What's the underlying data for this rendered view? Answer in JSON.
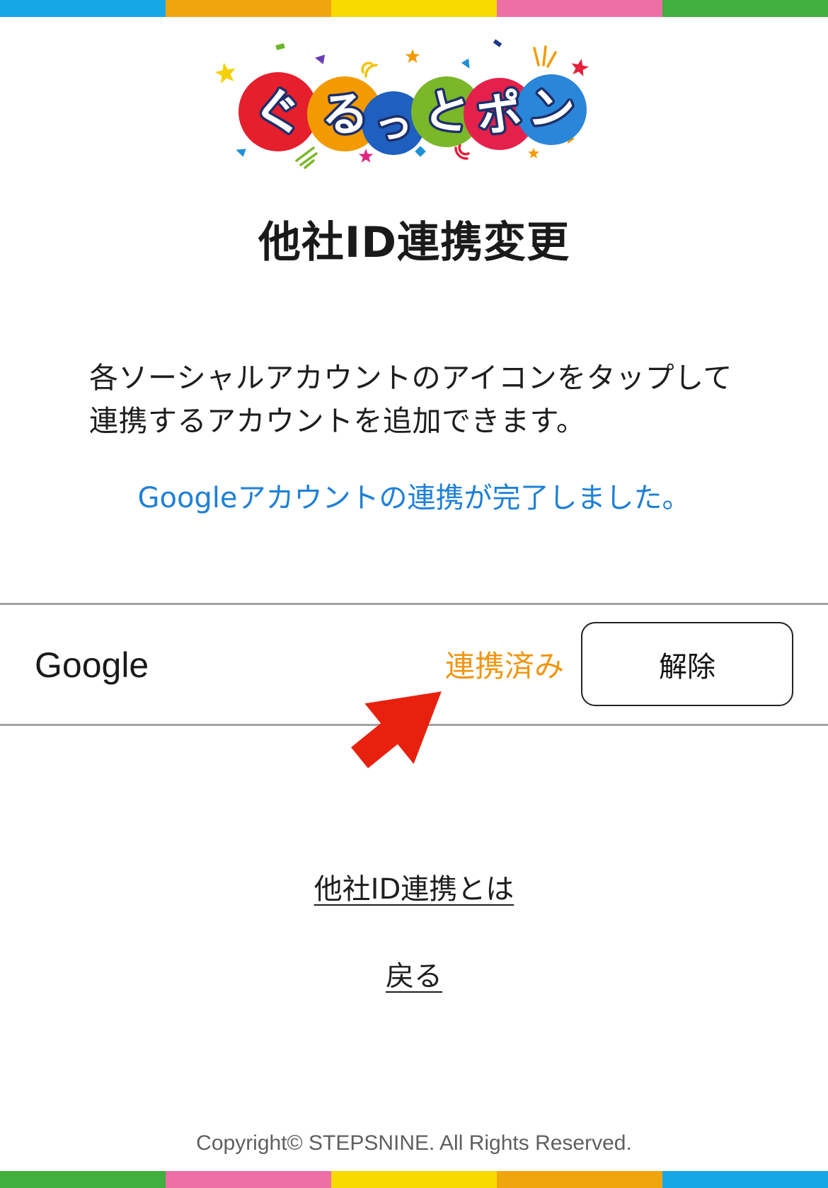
{
  "top_bar": {
    "colors": [
      "#16a8e6",
      "#f1a50c",
      "#f8d900",
      "#ec6fa6",
      "#3faf3e"
    ]
  },
  "logo": {
    "text": "ぐるっとポン",
    "chars": [
      "ぐ",
      "る",
      "っ",
      "と",
      "ポ",
      "ン"
    ],
    "circle_colors": [
      "#e51f2c",
      "#f39a00",
      "#1f5fbf",
      "#7ab729",
      "#e4214b",
      "#2a86d8"
    ]
  },
  "page_title": "他社ID連携変更",
  "description": {
    "lines": [
      "各ソーシャルアカウントのアイコンをタップして",
      "連携するアカウントを追加できます。"
    ]
  },
  "status_message": {
    "text": "Googleアカウントの連携が完了しました。",
    "color": "#1f80d6"
  },
  "accounts": [
    {
      "provider": "Google",
      "status": "連携済み",
      "status_color": "#f0950f",
      "action_label": "解除"
    }
  ],
  "links": {
    "about_label": "他社ID連携とは",
    "back_label": "戻る"
  },
  "footer": {
    "copyright": "Copyright© STEPSNINE. All Rights Reserved."
  },
  "bottom_bar": {
    "colors": [
      "#3faf3e",
      "#ec6fa6",
      "#f8d900",
      "#f1a50c",
      "#16a8e6"
    ]
  },
  "annotation": {
    "arrow_color": "#e8210f"
  }
}
